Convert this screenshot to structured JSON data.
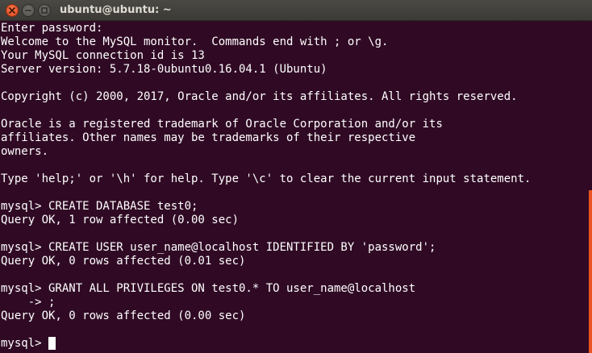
{
  "window": {
    "title": "ubuntu@ubuntu: ~"
  },
  "colors": {
    "background": "#300a24",
    "text": "#ffffff",
    "scrollbar_thumb": "#e95420",
    "close_button": "#e0461c"
  },
  "terminal": {
    "lines": [
      "Enter password:",
      "Welcome to the MySQL monitor.  Commands end with ; or \\g.",
      "Your MySQL connection id is 13",
      "Server version: 5.7.18-0ubuntu0.16.04.1 (Ubuntu)",
      "",
      "Copyright (c) 2000, 2017, Oracle and/or its affiliates. All rights reserved.",
      "",
      "Oracle is a registered trademark of Oracle Corporation and/or its",
      "affiliates. Other names may be trademarks of their respective",
      "owners.",
      "",
      "Type 'help;' or '\\h' for help. Type '\\c' to clear the current input statement.",
      "",
      "mysql> CREATE DATABASE test0;",
      "Query OK, 1 row affected (0.00 sec)",
      "",
      "mysql> CREATE USER user_name@localhost IDENTIFIED BY 'password';",
      "Query OK, 0 rows affected (0.01 sec)",
      "",
      "mysql> GRANT ALL PRIVILEGES ON test0.* TO user_name@localhost",
      "    -> ;",
      "Query OK, 0 rows affected (0.00 sec)",
      ""
    ],
    "prompt": "mysql> "
  },
  "icons": {
    "close": "close-icon",
    "minimize": "minimize-icon",
    "maximize": "maximize-icon"
  }
}
